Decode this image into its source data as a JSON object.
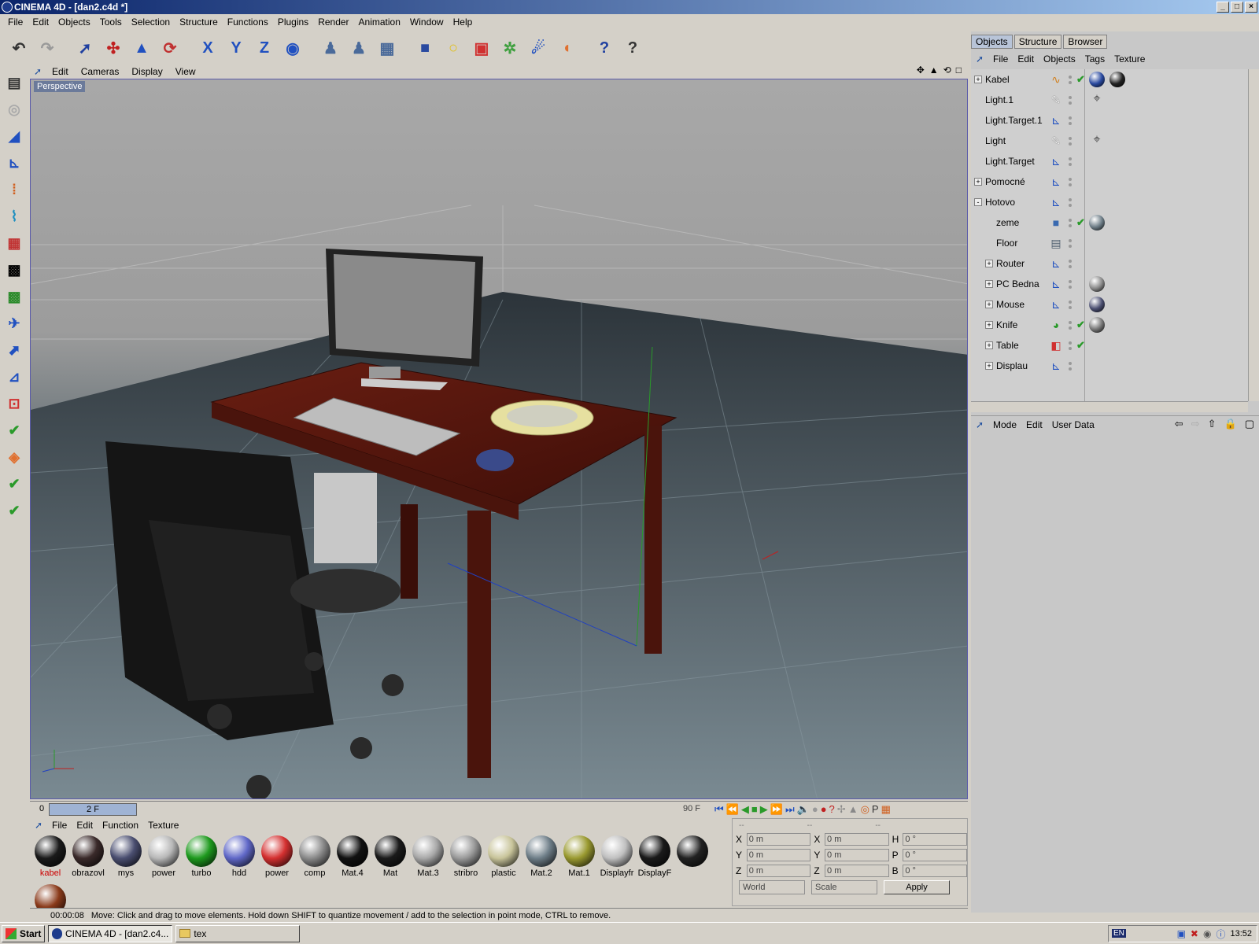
{
  "window": {
    "title": "CINEMA 4D - [dan2.c4d *]",
    "controls": [
      "_",
      "□",
      "×"
    ]
  },
  "menubar": [
    "File",
    "Edit",
    "Objects",
    "Tools",
    "Selection",
    "Structure",
    "Functions",
    "Plugins",
    "Render",
    "Animation",
    "Window",
    "Help"
  ],
  "viewport": {
    "menu": [
      "Edit",
      "Cameras",
      "Display",
      "View"
    ],
    "label": "Perspective"
  },
  "timeline": {
    "start": "0",
    "current": "2 F",
    "end": "90 F"
  },
  "materials": {
    "menu": [
      "File",
      "Edit",
      "Function",
      "Texture"
    ],
    "items": [
      {
        "label": "kabel",
        "color": "#1a1a1a",
        "selected": true
      },
      {
        "label": "obrazovl",
        "color": "#3a2a2a"
      },
      {
        "label": "mys",
        "color": "#4a4e70"
      },
      {
        "label": "power",
        "color": "#b8b8b8"
      },
      {
        "label": "turbo",
        "color": "#1e9a1e"
      },
      {
        "label": "hdd",
        "color": "#6068c8"
      },
      {
        "label": "power",
        "color": "#d43030"
      },
      {
        "label": "comp",
        "color": "#8a8a8a"
      },
      {
        "label": "Mat.4",
        "color": "#111111"
      },
      {
        "label": "Mat",
        "color": "#1a1a1a"
      },
      {
        "label": "Mat.3",
        "color": "#a8a8a8"
      },
      {
        "label": "stribro",
        "color": "#9a9a9a"
      },
      {
        "label": "plastic",
        "color": "#c8c49a"
      },
      {
        "label": "Mat.2",
        "color": "#6e7e88"
      },
      {
        "label": "Mat.1",
        "color": "#9a9a30"
      },
      {
        "label": "Displayfr",
        "color": "#c0c0c0"
      },
      {
        "label": "DisplayF",
        "color": "#1a1a1a"
      },
      {
        "label": "",
        "color": "#222222"
      },
      {
        "label": "",
        "color": "#8a3a1a"
      }
    ]
  },
  "coords": {
    "header": [
      "--",
      "--",
      "--"
    ],
    "rows": [
      {
        "a1": "X",
        "v1": "0 m",
        "a2": "X",
        "v2": "0 m",
        "a3": "H",
        "v3": "0 °"
      },
      {
        "a1": "Y",
        "v1": "0 m",
        "a2": "Y",
        "v2": "0 m",
        "a3": "P",
        "v3": "0 °"
      },
      {
        "a1": "Z",
        "v1": "0 m",
        "a2": "Z",
        "v2": "0 m",
        "a3": "B",
        "v3": "0 °"
      }
    ],
    "space": "World",
    "mode": "Scale",
    "apply": "Apply"
  },
  "status": {
    "time": "00:00:08",
    "message": "Move: Click and drag to move elements. Hold down SHIFT to quantize movement / add to the selection in point mode, CTRL to remove."
  },
  "objects": {
    "tabs": [
      "Objects",
      "Structure",
      "Browser"
    ],
    "menu": [
      "File",
      "Edit",
      "Objects",
      "Tags",
      "Texture"
    ],
    "rows": [
      {
        "name": "Kabel",
        "indent": 0,
        "expander": "+",
        "icon": "spline-icon",
        "check": true,
        "tags": [
          "#2a4aa0",
          "#222222"
        ]
      },
      {
        "name": "Light.1",
        "indent": 0,
        "expander": "",
        "icon": "light-icon",
        "check": false,
        "tags": [
          "target"
        ]
      },
      {
        "name": "Light.Target.1",
        "indent": 0,
        "expander": "",
        "icon": "null-icon",
        "check": false,
        "tags": []
      },
      {
        "name": "Light",
        "indent": 0,
        "expander": "",
        "icon": "light-icon",
        "check": false,
        "tags": [
          "target"
        ]
      },
      {
        "name": "Light.Target",
        "indent": 0,
        "expander": "",
        "icon": "null-icon",
        "check": false,
        "tags": []
      },
      {
        "name": "Pomocné",
        "indent": 0,
        "expander": "+",
        "icon": "null-icon",
        "check": false,
        "tags": []
      },
      {
        "name": "Hotovo",
        "indent": 0,
        "expander": "-",
        "icon": "null-icon",
        "check": false,
        "tags": []
      },
      {
        "name": "zeme",
        "indent": 1,
        "expander": "",
        "icon": "plane-icon",
        "check": true,
        "tags": [
          "#6e7e88"
        ]
      },
      {
        "name": "Floor",
        "indent": 1,
        "expander": "",
        "icon": "floor-icon",
        "check": false,
        "tags": []
      },
      {
        "name": "Router",
        "indent": 1,
        "expander": "+",
        "icon": "null-icon",
        "check": false,
        "tags": []
      },
      {
        "name": "PC Bedna",
        "indent": 1,
        "expander": "+",
        "icon": "null-icon",
        "check": false,
        "tags": [
          "#8a8a8a"
        ]
      },
      {
        "name": "Mouse",
        "indent": 1,
        "expander": "+",
        "icon": "null-icon",
        "check": false,
        "tags": [
          "#4a4e70"
        ]
      },
      {
        "name": "Knife",
        "indent": 1,
        "expander": "+",
        "icon": "sweep-icon",
        "check": true,
        "tags": [
          "#777777"
        ]
      },
      {
        "name": "Table",
        "indent": 1,
        "expander": "+",
        "icon": "cube-icon",
        "check": true,
        "tags": []
      },
      {
        "name": "Displau",
        "indent": 1,
        "expander": "+",
        "icon": "null-icon",
        "check": false,
        "tags": []
      }
    ]
  },
  "attributes": {
    "menu": [
      "Mode",
      "Edit",
      "User Data"
    ]
  },
  "taskbar": {
    "start": "Start",
    "tasks": [
      {
        "label": "CINEMA 4D - [dan2.c4...",
        "active": true
      },
      {
        "label": "tex",
        "active": false
      }
    ],
    "lang": "EN",
    "clock": "13:52"
  }
}
